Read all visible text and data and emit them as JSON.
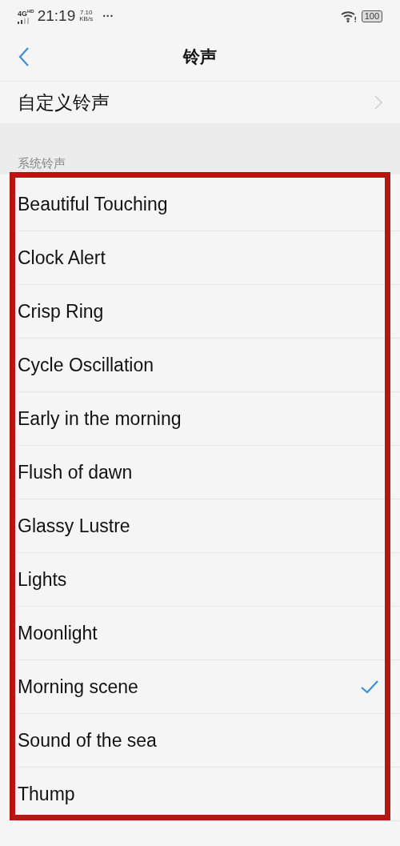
{
  "status_bar": {
    "network": "4G",
    "network_sup": "HD",
    "time": "21:19",
    "speed": "7.10",
    "speed_unit": "KB/s",
    "more": "···",
    "battery": "100"
  },
  "header": {
    "title": "铃声"
  },
  "custom_item": {
    "label": "自定义铃声"
  },
  "section": {
    "label": "系统铃声"
  },
  "ringtones": [
    {
      "name": "Beautiful Touching",
      "selected": false
    },
    {
      "name": "Clock Alert",
      "selected": false
    },
    {
      "name": "Crisp Ring",
      "selected": false
    },
    {
      "name": "Cycle Oscillation",
      "selected": false
    },
    {
      "name": "Early in the morning",
      "selected": false
    },
    {
      "name": "Flush of dawn",
      "selected": false
    },
    {
      "name": "Glassy Lustre",
      "selected": false
    },
    {
      "name": "Lights",
      "selected": false
    },
    {
      "name": "Moonlight",
      "selected": false
    },
    {
      "name": "Morning scene",
      "selected": true
    },
    {
      "name": "Sound of the sea",
      "selected": false
    },
    {
      "name": "Thump",
      "selected": false
    }
  ],
  "highlight": {
    "color": "#b8150f"
  }
}
